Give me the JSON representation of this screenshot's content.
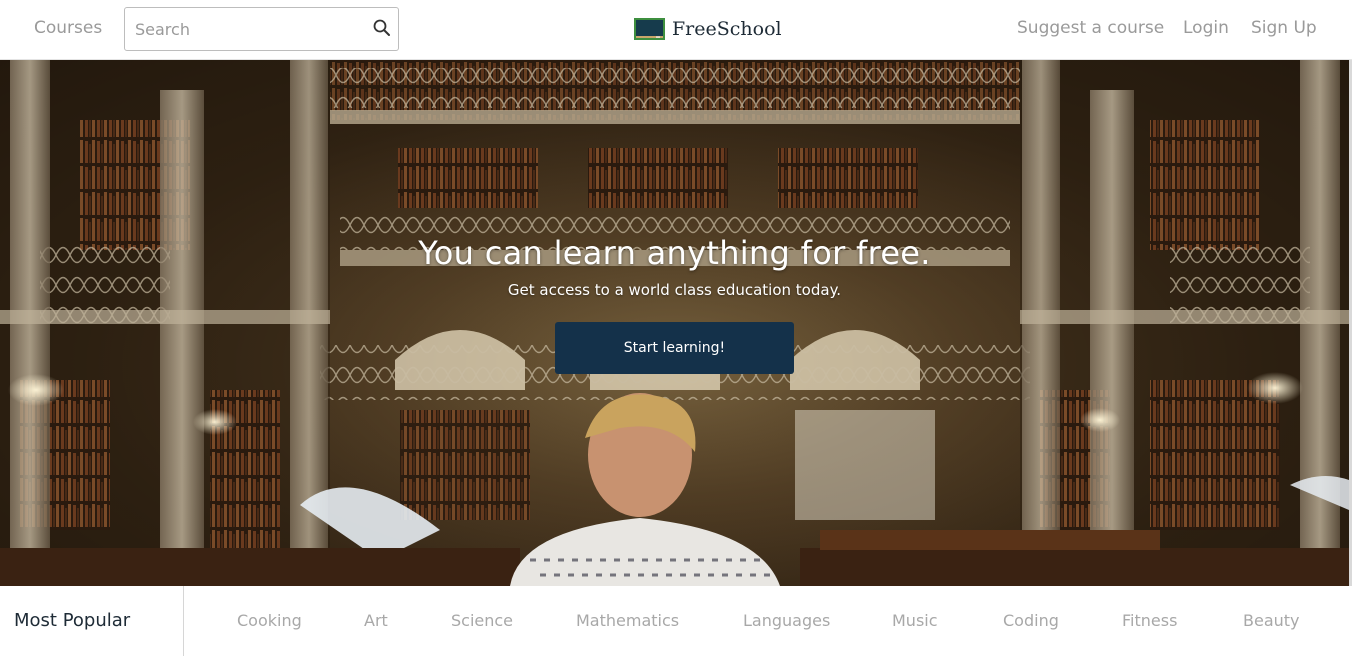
{
  "nav": {
    "courses_label": "Courses",
    "search_placeholder": "Search",
    "search_value": "",
    "brand_name": "FreeSchool",
    "suggest_label": "Suggest a course",
    "login_label": "Login",
    "signup_label": "Sign Up",
    "icons": {
      "search": "search-icon",
      "logo": "chalkboard-logo-icon"
    }
  },
  "hero": {
    "title": "You can learn anything for free.",
    "subtitle": "Get access to a world class education today.",
    "cta_label": "Start learning!",
    "background": "library-interior-with-student-photo"
  },
  "categories": {
    "heading": "Most Popular",
    "items": [
      "Cooking",
      "Art",
      "Science",
      "Mathematics",
      "Languages",
      "Music",
      "Coding",
      "Fitness",
      "Beauty"
    ]
  },
  "colors": {
    "cta_background": "#14314a",
    "nav_text": "#9a9a9a",
    "category_text": "#a8a8a8",
    "heading_text": "#1e2b36",
    "logo_board": "#163b4c",
    "logo_frame": "#3e8f3f"
  }
}
